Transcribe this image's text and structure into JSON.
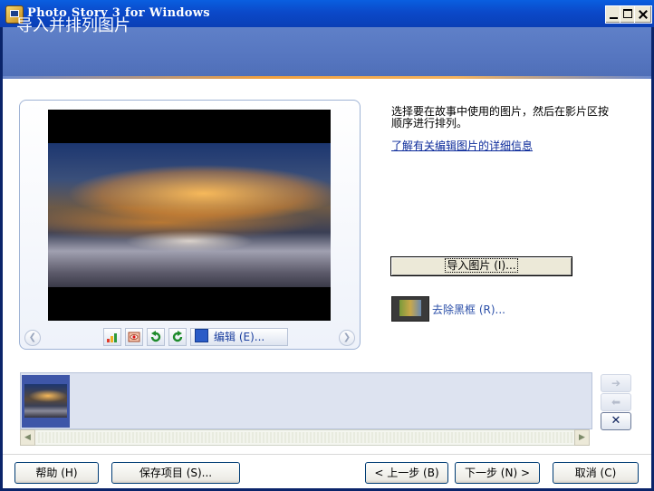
{
  "window": {
    "title": "Photo Story 3 for Windows",
    "controls": [
      "minimize",
      "maximize",
      "close"
    ]
  },
  "header": {
    "title": "导入并排列图片"
  },
  "preview": {
    "toolbar": {
      "edit_label": "编辑 (E)..."
    },
    "icons": [
      "levels-icon",
      "red-eye-icon",
      "rotate-left-icon",
      "rotate-right-icon",
      "edit-icon"
    ]
  },
  "instructions": {
    "text": "选择要在故事中使用的图片，然后在影片区按顺序进行排列。",
    "learn_link": "了解有关编辑图片的详细信息"
  },
  "actions": {
    "import_label": "导入图片 (I)...",
    "remove_borders_label": "去除黑框 (R)..."
  },
  "filmstrip": {
    "items": [
      {
        "selected": true
      }
    ],
    "move_right": "➔",
    "move_left": "⬅",
    "delete": "✕"
  },
  "footer": {
    "help": "帮助 (H)",
    "save": "保存项目 (S)...",
    "back": "< 上一步 (B)",
    "next": "下一步 (N) >",
    "cancel": "取消 (C)"
  },
  "colors": {
    "titlebar": "#0B49C9",
    "header": "#5676C0",
    "link": "#0B2A9A",
    "filmstrip": "#DDE3F0"
  }
}
